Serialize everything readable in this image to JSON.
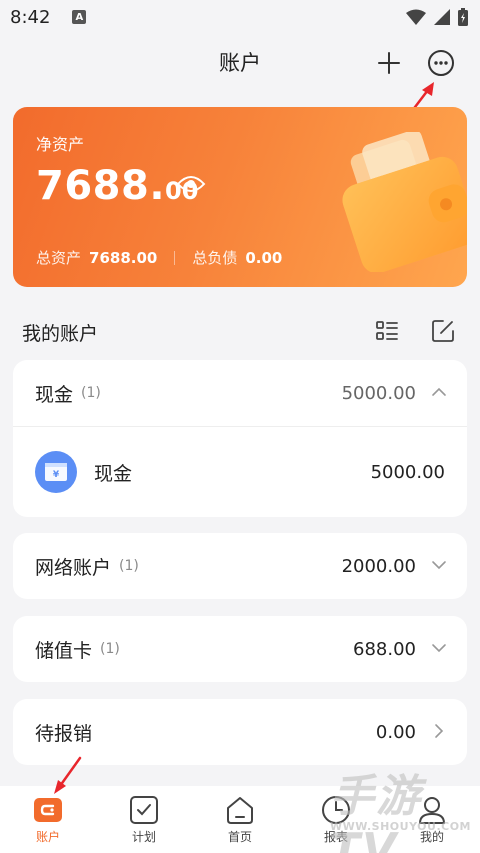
{
  "status": {
    "time": "8:42",
    "notification_badge": "A"
  },
  "header": {
    "title": "账户"
  },
  "asset_card": {
    "label": "净资产",
    "amount_int": "7688.",
    "amount_dec": "00",
    "total_assets_label": "总资产",
    "total_assets_value": "7688.00",
    "total_liabilities_label": "总负债",
    "total_liabilities_value": "0.00"
  },
  "section": {
    "title": "我的账户"
  },
  "groups": [
    {
      "name": "现金",
      "count": "(1)",
      "value": "5000.00",
      "expanded": true,
      "accounts": [
        {
          "name": "现金",
          "value": "5000.00",
          "icon": "cash-icon"
        }
      ]
    },
    {
      "name": "网络账户",
      "count": "(1)",
      "value": "2000.00",
      "expanded": false
    },
    {
      "name": "储值卡",
      "count": "(1)",
      "value": "688.00",
      "expanded": false
    },
    {
      "name": "待报销",
      "count": "",
      "value": "0.00",
      "expanded": false
    }
  ],
  "tabbar": {
    "items": [
      {
        "label": "账户",
        "icon": "wallet-icon",
        "active": true
      },
      {
        "label": "计划",
        "icon": "checkbox-icon",
        "active": false
      },
      {
        "label": "首页",
        "icon": "home-icon",
        "active": false
      },
      {
        "label": "报表",
        "icon": "clock-report-icon",
        "active": false
      },
      {
        "label": "我的",
        "icon": "user-icon",
        "active": false
      }
    ]
  },
  "colors": {
    "accent": "#f26b2c",
    "card_start": "#f26b2c",
    "card_end": "#ffa64e",
    "cash_icon_bg": "#5b8ef5",
    "annotation_arrow": "#e8262c"
  },
  "watermark": {
    "text": "手游TV",
    "url": "WWW.SHOUYOU.COM"
  }
}
